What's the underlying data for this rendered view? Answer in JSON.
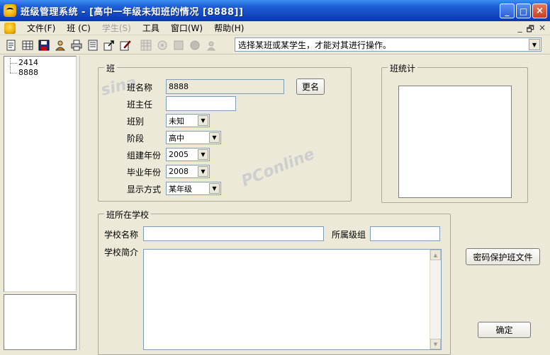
{
  "window": {
    "title": "班级管理系统 - [高中一年级未知班的情况   [8888]]",
    "minimize": "_",
    "maximize": "□",
    "close": "×"
  },
  "menu": {
    "items": [
      "文件(F)",
      "班 (C)",
      "学生(S)",
      "工具",
      "窗口(W)",
      "帮助(H)"
    ],
    "mdi_min": "_",
    "mdi_restore": "🗗",
    "mdi_close": "×"
  },
  "toolbar": {
    "hint": "选择某班或某学生，才能对其进行操作。",
    "icons": [
      "new-icon",
      "grid-icon",
      "save-icon",
      "user-icon",
      "print-icon",
      "report-icon",
      "export-icon",
      "edit-icon",
      "tool1-icon",
      "tool2-icon",
      "tool3-icon",
      "tool4-icon",
      "tool5-icon"
    ]
  },
  "tree": {
    "items": [
      "2414",
      "8888"
    ]
  },
  "class_group": {
    "title": "班",
    "name_label": "班名称",
    "name_value": "8888",
    "rename_button": "更名",
    "teacher_label": "班主任",
    "teacher_value": "",
    "type_label": "班别",
    "type_value": "未知",
    "stage_label": "阶段",
    "stage_value": "高中",
    "year_label": "组建年份",
    "year_value": "2005",
    "grad_label": "毕业年份",
    "grad_value": "2008",
    "display_label": "显示方式",
    "display_value": "某年级"
  },
  "stats_group": {
    "title": "班统计"
  },
  "school_group": {
    "title": "班所在学校",
    "name_label": "学校名称",
    "name_value": "",
    "grade_label": "所属级组",
    "grade_value": "",
    "intro_label": "学校简介",
    "intro_value": ""
  },
  "buttons": {
    "protect": "密码保护班文件",
    "ok": "确定"
  },
  "watermarks": {
    "sina": "sina",
    "pconline": "PConline"
  }
}
